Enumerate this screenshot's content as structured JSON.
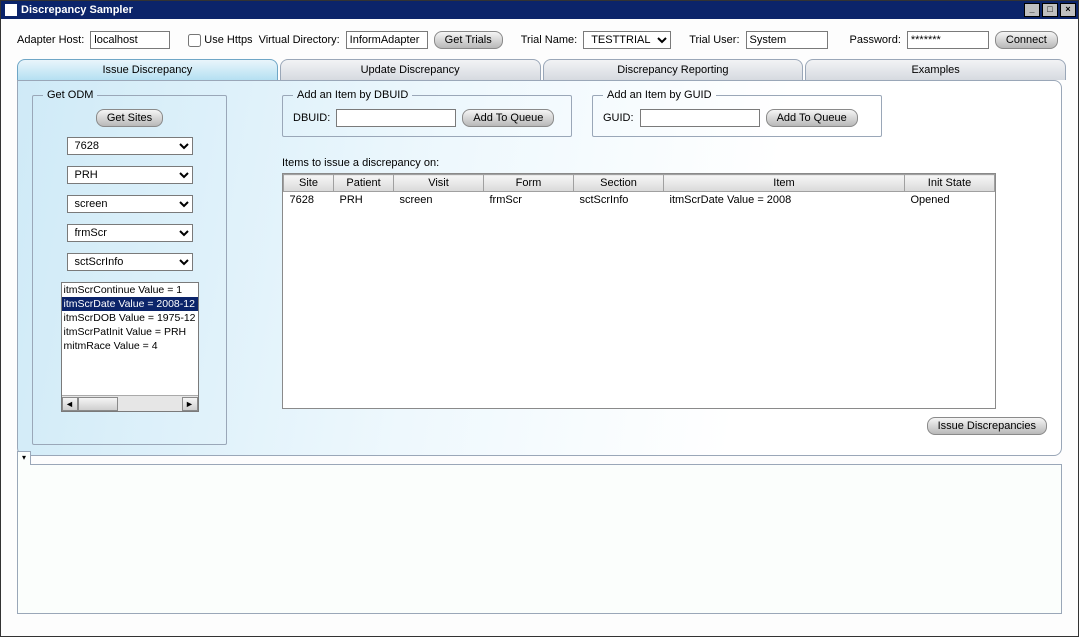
{
  "window": {
    "title": "Discrepancy Sampler"
  },
  "toolbar": {
    "adapter_host_label": "Adapter Host:",
    "adapter_host_value": "localhost",
    "use_https_label": "Use Https",
    "virtual_dir_label": "Virtual Directory:",
    "virtual_dir_value": "InformAdapter",
    "get_trials_label": "Get Trials",
    "trial_name_label": "Trial Name:",
    "trial_name_value": "TESTTRIAL",
    "trial_user_label": "Trial User:",
    "trial_user_value": "System",
    "password_label": "Password:",
    "password_value": "*******",
    "connect_label": "Connect"
  },
  "tabs": {
    "t0": "Issue Discrepancy",
    "t1": "Update Discrepancy",
    "t2": "Discrepancy Reporting",
    "t3": "Examples"
  },
  "getodm": {
    "legend": "Get ODM",
    "get_sites_label": "Get Sites",
    "site_value": "7628",
    "patient_value": "PRH",
    "visit_value": "screen",
    "form_value": "frmScr",
    "section_value": "sctScrInfo",
    "items": [
      "itmScrContinue Value = 1",
      "itmScrDate Value = 2008-12",
      "itmScrDOB Value = 1975-12",
      "itmScrPatInit Value = PRH",
      "mitmRace Value = 4"
    ]
  },
  "add_dbuid": {
    "legend": "Add an Item by DBUID",
    "label": "DBUID:",
    "btn": "Add To Queue"
  },
  "add_guid": {
    "legend": "Add an Item by GUID",
    "label": "GUID:",
    "btn": "Add To Queue"
  },
  "queue": {
    "label": "Items to issue a discrepancy on:",
    "columns": [
      "Site",
      "Patient",
      "Visit",
      "Form",
      "Section",
      "Item",
      "Init State"
    ],
    "rows": [
      {
        "site": "7628",
        "patient": "PRH",
        "visit": "screen",
        "form": "frmScr",
        "section": "sctScrInfo",
        "item": "itmScrDate Value = 2008",
        "initstate": "Opened"
      }
    ]
  },
  "issue_btn": "Issue Discrepancies"
}
